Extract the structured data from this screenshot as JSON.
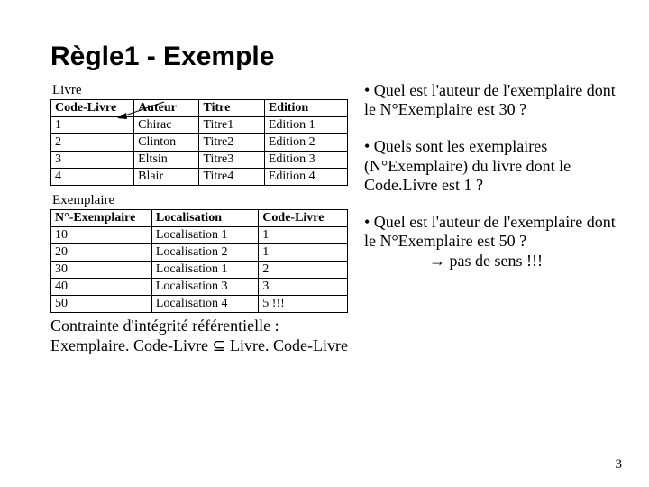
{
  "title": "Règle1 - Exemple",
  "tables": {
    "livre": {
      "label": "Livre",
      "headers": [
        "Code-Livre",
        "Auteur",
        "Titre",
        "Edition"
      ],
      "rows": [
        [
          "1",
          "Chirac",
          "Titre1",
          "Edition 1"
        ],
        [
          "2",
          "Clinton",
          "Titre2",
          "Edition 2"
        ],
        [
          "3",
          "Eltsin",
          "Titre3",
          "Edition 3"
        ],
        [
          "4",
          "Blair",
          "Titre4",
          "Edition 4"
        ]
      ]
    },
    "exemplaire": {
      "label": "Exemplaire",
      "headers": [
        "N°-Exemplaire",
        "Localisation",
        "Code-Livre"
      ],
      "rows": [
        [
          "10",
          "Localisation 1",
          "1"
        ],
        [
          "20",
          "Localisation 2",
          "1"
        ],
        [
          "30",
          "Localisation 1",
          "2"
        ],
        [
          "40",
          "Localisation 3",
          "3"
        ],
        [
          "50",
          "Localisation 4",
          "5  !!!"
        ]
      ]
    }
  },
  "questions": {
    "q1": "• Quel est l'auteur de l'exemplaire dont le N°Exemplaire est 30 ?",
    "q2": "• Quels sont les exemplaires (N°Exemplaire) du livre dont le Code.Livre est 1 ?",
    "q3": "• Quel est l'auteur de l'exemplaire dont le N°Exemplaire est 50 ?",
    "q3_answer": "→ pas de sens !!!"
  },
  "constraint": {
    "line1": "Contrainte d'intégrité référentielle :",
    "line2": "Exemplaire. Code-Livre ⊆ Livre. Code-Livre"
  },
  "page_number": "3"
}
